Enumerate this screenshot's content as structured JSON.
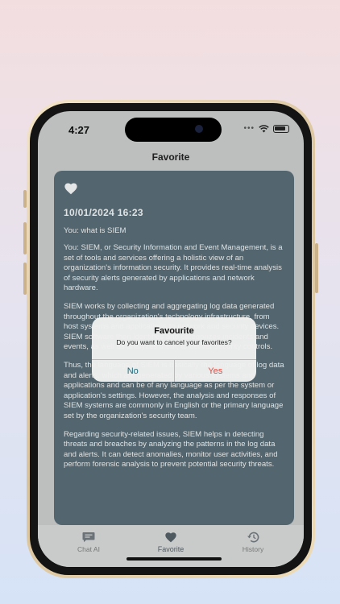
{
  "status_bar": {
    "time": "4:27",
    "signal": "•••"
  },
  "nav": {
    "title": "Favorite"
  },
  "entry": {
    "timestamp": "10/01/2024 16:23",
    "question": "You: what is SIEM",
    "answer_paragraphs": [
      "You: SIEM, or Security Information and Event Management, is a set of tools and services offering a holistic view of an organization's information security. It provides real-time analysis of security alerts generated by applications and network hardware.",
      "SIEM works by collecting and aggregating log data generated throughout the organization's technology infrastructure, from host systems and applications to network and security devices. SIEM software then identifies and categorizes incidents and events, as well as analyzes them, to deliver security controls.",
      "Thus, the language of SIEM is basically the language of log data and alerts, which are generated by various systems and applications and can be of any language as per the system or application's settings. However, the analysis and responses of SIEM systems are commonly in English or the primary language set by the organization's security team.",
      "Regarding security-related issues, SIEM helps in detecting threats and breaches by analyzing the patterns in the log data and alerts. It can detect anomalies, monitor user activities, and perform forensic analysis to prevent potential security threats."
    ]
  },
  "dialog": {
    "title": "Favourite",
    "message": "Do you want to cancel your favorites?",
    "no_label": "No",
    "yes_label": "Yes"
  },
  "tabs": [
    {
      "label": "Chat AI",
      "icon": "chat-icon"
    },
    {
      "label": "Favorite",
      "icon": "heart-icon",
      "active": true
    },
    {
      "label": "History",
      "icon": "history-icon"
    }
  ],
  "colors": {
    "card": "#596c75",
    "yes": "#e04b3f",
    "no": "#1f6a7a"
  }
}
